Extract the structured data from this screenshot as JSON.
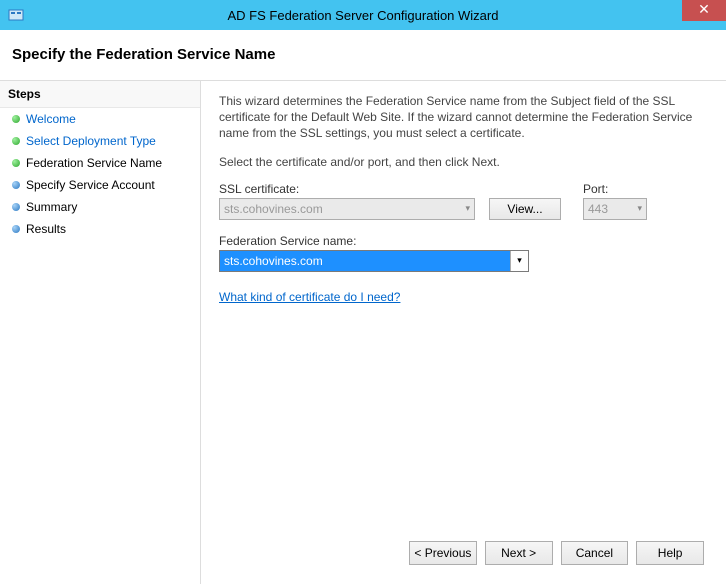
{
  "window": {
    "title": "AD FS Federation Server Configuration Wizard"
  },
  "page": {
    "heading": "Specify the Federation Service Name"
  },
  "sidebar": {
    "header": "Steps",
    "items": [
      {
        "label": "Welcome",
        "status": "done",
        "link": true
      },
      {
        "label": "Select Deployment Type",
        "status": "done",
        "link": true
      },
      {
        "label": "Federation Service Name",
        "status": "current",
        "link": false
      },
      {
        "label": "Specify Service Account",
        "status": "pending",
        "link": false
      },
      {
        "label": "Summary",
        "status": "pending",
        "link": false
      },
      {
        "label": "Results",
        "status": "pending",
        "link": false
      }
    ]
  },
  "content": {
    "intro": "This wizard determines the Federation Service name from the Subject field of the SSL certificate for the Default Web Site.  If the wizard cannot determine the Federation Service name from the SSL settings, you must select a certificate.",
    "selectLine": "Select the certificate and/or port, and then click Next.",
    "sslLabel": "SSL certificate:",
    "sslValue": "sts.cohovines.com",
    "viewLabel": "View...",
    "portLabel": "Port:",
    "portValue": "443",
    "fedLabel": "Federation Service name:",
    "fedValue": "sts.cohovines.com",
    "helpLink": "What kind of certificate do I need?"
  },
  "buttons": {
    "previous": "< Previous",
    "next": "Next >",
    "cancel": "Cancel",
    "help": "Help"
  }
}
